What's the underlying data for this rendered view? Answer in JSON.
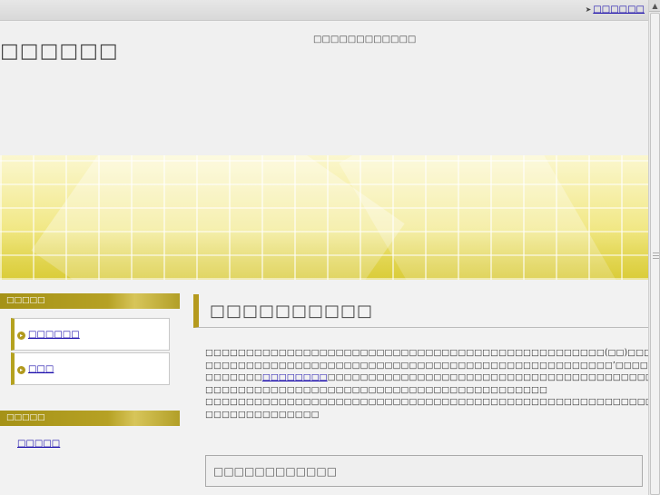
{
  "topbar": {
    "link_label": "□□□□□□"
  },
  "header": {
    "site_title": "□□□□□□",
    "site_description": "□□□□□□□□□□□□"
  },
  "sidebar": {
    "section1_title": "□□□□□",
    "items": [
      {
        "label": "□□□□□□"
      },
      {
        "label": "□□□"
      }
    ],
    "section2_title": "□□□□□",
    "section2_link": "□□□□□"
  },
  "main": {
    "title": "□□□□□□□□□□",
    "para1": "□□□□□□□□□□□□□□□□□□□□□□□□□□□□□□□□□□□□□□□□□□□□□□□□□(□□)□□□□□□□□□□□□□□□□□□□□",
    "para2": "□□□□□□□□□□□□□□□□□□□□□□□□□□□□□□□□□□□□□□□□□□□□□□□□□□’□□□□□□□□□□□□□□□□□□□□□□□□□□□□□□□□□□□□□□□□□□□□□□□□□□□□□□□□□□□□□",
    "para3_before": "□□□□□□□",
    "para3_link": "□□□□□□□□",
    "para3_after": "□□□□□□□□□□□□□□□□□□□□□□□□□□□□□□□□□□□□□□□□□□□□□",
    "para4": "□□□□□□□□□□□□□□□□□□□□□□□□□□□□□□□□□□□□□□□□□□",
    "para5": "□□□□□□□□□□□□□□□□□□□□□□□□□□□□□□□□□□□□□□□□□□□□□□□□□□□□□□□□□□□□□□□□□□□□□□□□□□□□□□□□□□□□□□□□□□□□□□",
    "para6": "□□□□□□□□□□□□□□",
    "subheading": "□□□□□□□□□□□□"
  },
  "colors": {
    "accent": "#b59a1e",
    "link": "#1a0dab",
    "background": "#f2f2f2"
  }
}
